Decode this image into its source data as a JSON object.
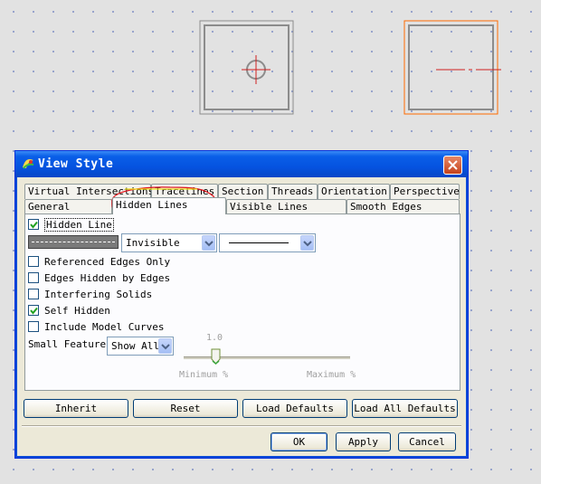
{
  "colors": {
    "canvas_bg": "#e2e2e2",
    "titlebar": "#0553e0",
    "selected_view_border": "#ff6a00",
    "annotation_red": "#e0141c",
    "annotation_yellow": "#f2e01a"
  },
  "dialog": {
    "title": "View Style",
    "app_icon": "ptc-logo-icon",
    "close_icon": "close-icon"
  },
  "tabs_row1": [
    {
      "label": "Virtual Intersections"
    },
    {
      "label": "Tracelines"
    },
    {
      "label": "Section"
    },
    {
      "label": "Threads"
    },
    {
      "label": "Orientation"
    },
    {
      "label": "Perspective"
    }
  ],
  "tabs_row2": [
    {
      "label": "General"
    },
    {
      "label": "Hidden Lines",
      "active": true
    },
    {
      "label": "Visible Lines"
    },
    {
      "label": "Smooth Edges"
    }
  ],
  "panel": {
    "hidden_line": {
      "label": "Hidden Line",
      "checked": true
    },
    "style_combo": {
      "value": "Invisible"
    },
    "options": [
      {
        "label": "Referenced Edges Only",
        "checked": false
      },
      {
        "label": "Edges Hidden by Edges",
        "checked": false
      },
      {
        "label": "Interfering Solids",
        "checked": false
      },
      {
        "label": "Self Hidden",
        "checked": true
      },
      {
        "label": "Include Model Curves",
        "checked": false
      }
    ],
    "small_features": {
      "label": "Small Features",
      "value": "Show All"
    },
    "slider": {
      "value_label": "1.0",
      "min_label": "Minimum %",
      "max_label": "Maximum %",
      "fraction": 0.0
    }
  },
  "buttons": {
    "inherit": "Inherit",
    "reset": "Reset",
    "load_defaults": "Load Defaults",
    "load_all_defaults": "Load All Defaults",
    "ok": "OK",
    "apply": "Apply",
    "cancel": "Cancel"
  }
}
